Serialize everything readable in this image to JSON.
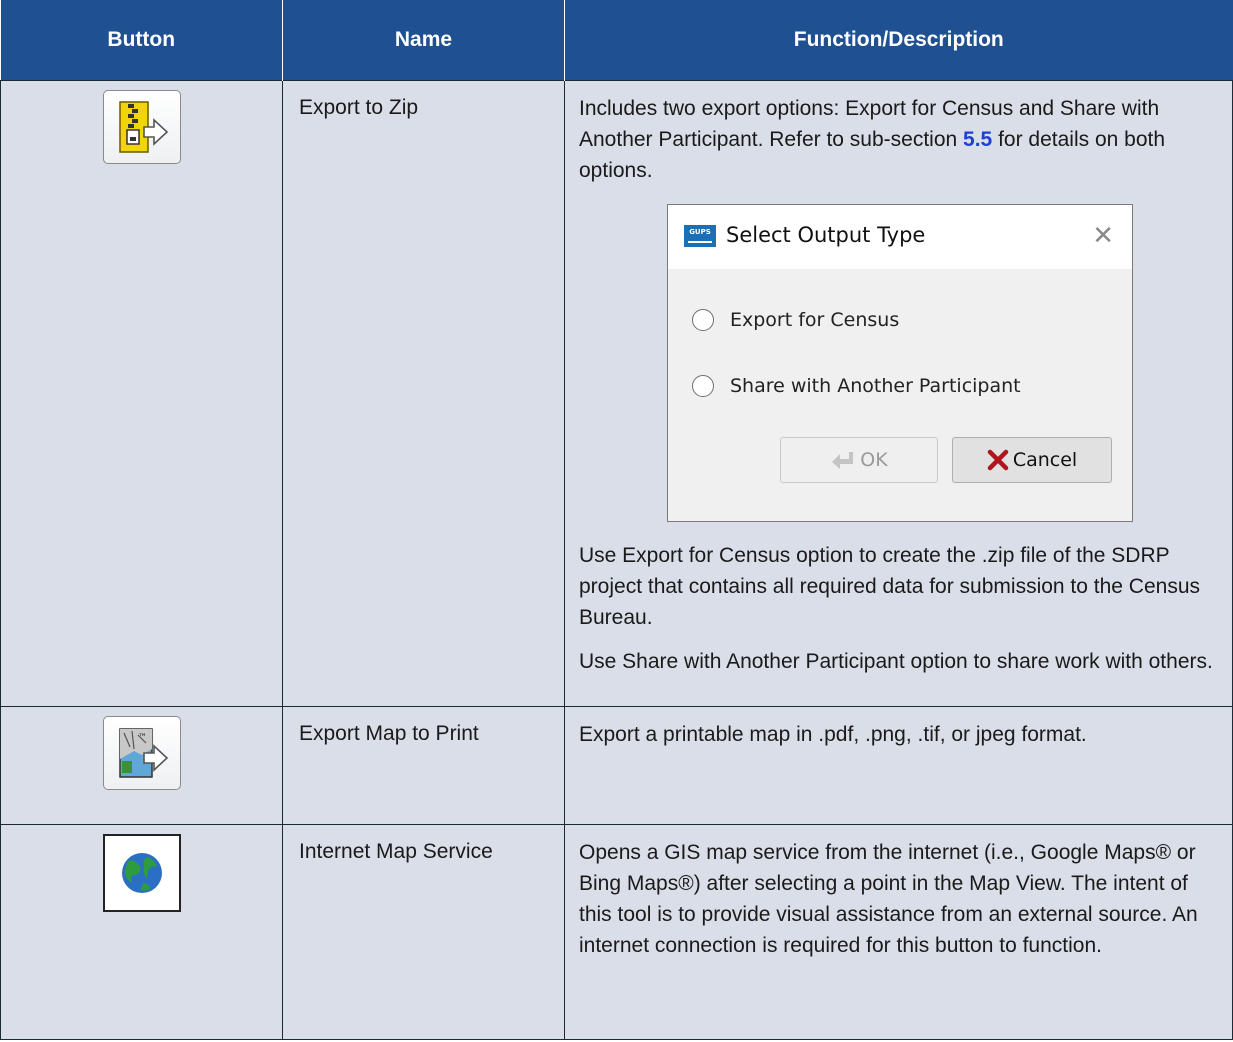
{
  "headers": {
    "button": "Button",
    "name": "Name",
    "description": "Function/Description"
  },
  "rows": [
    {
      "icon": "export-zip-icon",
      "name": "Export to Zip",
      "desc_before_link": "Includes two export options: Export for Census and Share with Another Participant. Refer to sub-section ",
      "desc_link": "5.5",
      "desc_after_link": " for details on both options.",
      "para2": "Use Export for Census option to create the .zip file of the SDRP project that contains all required data for submission to the Census Bureau.",
      "para3": "Use Share with Another Participant option to share work with others."
    },
    {
      "icon": "export-map-print-icon",
      "name": "Export Map to Print",
      "desc": "Export a printable map in .pdf, .png, .tif, or jpeg format."
    },
    {
      "icon": "globe-icon",
      "name": "Internet Map Service",
      "desc": "Opens a GIS map service from the internet (i.e., Google Maps® or Bing Maps®) after selecting a point in the Map View. The intent of this tool is to provide visual assistance from an external source. An internet connection is required for this button to function."
    }
  ],
  "dialog": {
    "logo_text": "GUPS",
    "title": "Select Output Type",
    "close_glyph": "✕",
    "options": [
      "Export for Census",
      "Share with Another Participant"
    ],
    "ok_label": "OK",
    "cancel_label": "Cancel"
  },
  "colors": {
    "header_bg": "#1f5091",
    "cell_bg": "#d9dee8",
    "link": "#1f3fd6"
  }
}
